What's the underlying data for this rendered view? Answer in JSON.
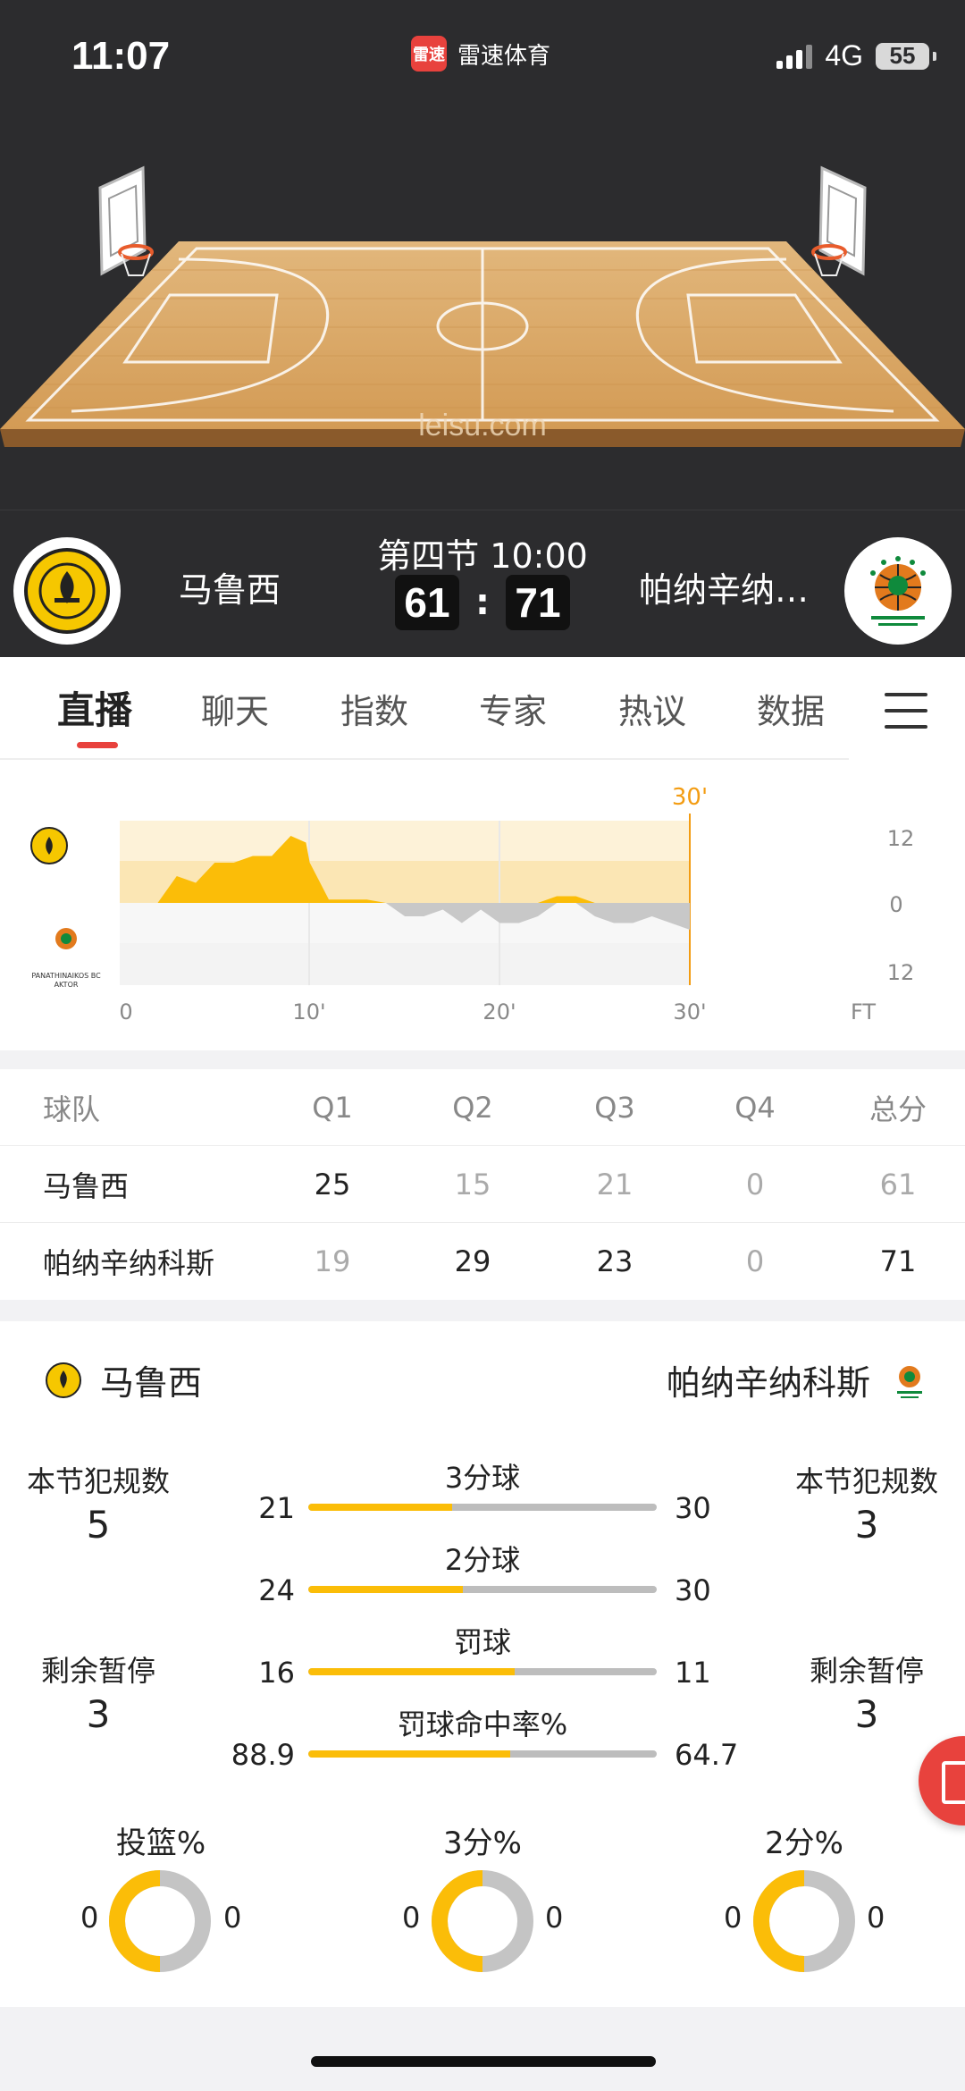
{
  "status_bar": {
    "time": "11:07",
    "app_icon_text": "雷速",
    "app_name": "雷速体育",
    "network": "4G",
    "battery": "55"
  },
  "court": {
    "watermark": "leisu.com"
  },
  "match": {
    "period": "第四节 10:00",
    "home": {
      "name": "马鲁西",
      "score": "61",
      "logo_icon": "maroussi-logo-icon"
    },
    "away": {
      "name": "帕纳辛纳…",
      "score": "71",
      "logo_icon": "panathinaikos-logo-icon"
    },
    "colon": ":"
  },
  "tabs": [
    "直播",
    "聊天",
    "指数",
    "专家",
    "热议",
    "数据"
  ],
  "active_tab": 0,
  "momentum": {
    "current_minute_label": "30'",
    "x_ticks": [
      "0",
      "10'",
      "20'",
      "30'",
      "FT"
    ],
    "y_ticks": [
      "12",
      "0",
      "12"
    ],
    "series_diff": [
      [
        0,
        0
      ],
      [
        2,
        0
      ],
      [
        3,
        4
      ],
      [
        4,
        3
      ],
      [
        5,
        6
      ],
      [
        6,
        6
      ],
      [
        7,
        7
      ],
      [
        8,
        7
      ],
      [
        9,
        10
      ],
      [
        9.8,
        9
      ],
      [
        10,
        6
      ],
      [
        11,
        0.5
      ],
      [
        13,
        0.5
      ],
      [
        14,
        0
      ],
      [
        15,
        -2
      ],
      [
        16,
        -2
      ],
      [
        17,
        -1
      ],
      [
        18,
        -3
      ],
      [
        19,
        -1
      ],
      [
        20,
        -3
      ],
      [
        21,
        -3
      ],
      [
        22,
        -2
      ],
      [
        23,
        1
      ],
      [
        24,
        1
      ],
      [
        25,
        -2
      ],
      [
        26,
        -3
      ],
      [
        27,
        -3
      ],
      [
        28,
        -2
      ],
      [
        29,
        -3
      ],
      [
        30,
        -4
      ]
    ],
    "colors": {
      "home": "#fbbd08",
      "away": "#c8c8c8",
      "accent": "#f39c12"
    }
  },
  "quarter_table": {
    "headers": [
      "球队",
      "Q1",
      "Q2",
      "Q3",
      "Q4",
      "总分"
    ],
    "rows": [
      {
        "team": "马鲁西",
        "q": [
          "25",
          "15",
          "21",
          "0",
          "61"
        ]
      },
      {
        "team": "帕纳辛纳科斯",
        "q": [
          "19",
          "29",
          "23",
          "0",
          "71"
        ]
      }
    ]
  },
  "stats": {
    "home_team": "马鲁西",
    "away_team": "帕纳辛纳科斯",
    "fouls_label": "本节犯规数",
    "home_fouls": "5",
    "away_fouls": "3",
    "timeouts_label": "剩余暂停",
    "home_timeouts": "3",
    "away_timeouts": "3",
    "bars": [
      {
        "label": "3分球",
        "home": "21",
        "away": "30"
      },
      {
        "label": "2分球",
        "home": "24",
        "away": "30"
      },
      {
        "label": "罚球",
        "home": "16",
        "away": "11"
      },
      {
        "label": "罚球命中率%",
        "home": "88.9",
        "away": "64.7"
      }
    ],
    "donuts": [
      {
        "label": "投篮%",
        "home": "0",
        "away": "0"
      },
      {
        "label": "3分%",
        "home": "0",
        "away": "0"
      },
      {
        "label": "2分%",
        "home": "0",
        "away": "0"
      }
    ]
  }
}
